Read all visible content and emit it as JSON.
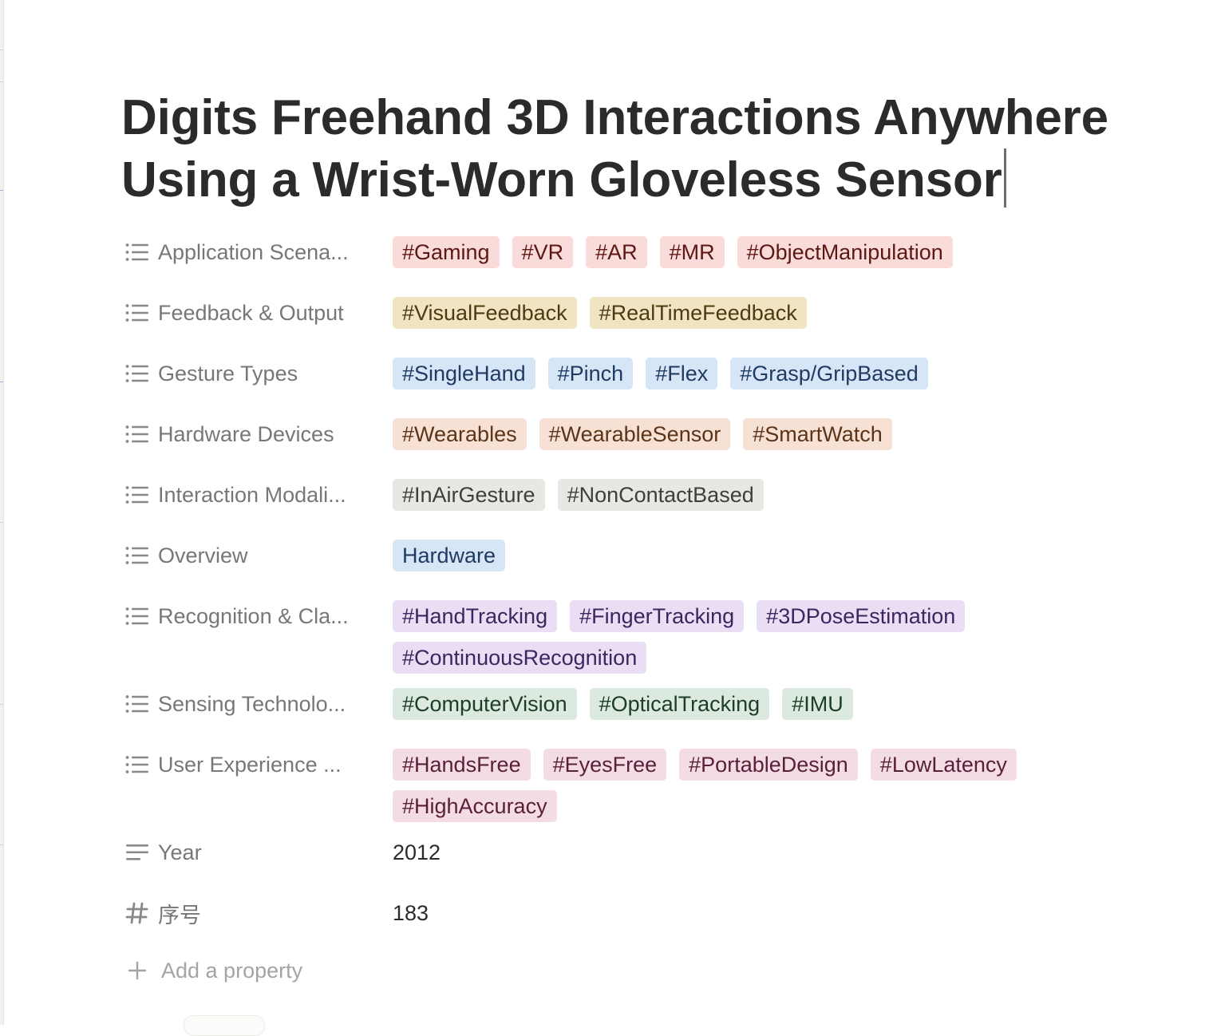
{
  "page": {
    "title": "Digits Freehand 3D Interactions Anywhere Using a Wrist-Worn Gloveless Sensor"
  },
  "colors": {
    "red_bg": "#f9dcd9",
    "red_fg": "#5d1715",
    "yellow_bg": "#f1e4c3",
    "yellow_fg": "#4f3a0f",
    "blue_bg": "#d7e6f7",
    "blue_fg": "#1f3b63",
    "orange_bg": "#f6e1d4",
    "orange_fg": "#5c3418",
    "gray_bg": "#e8e7e4",
    "gray_fg": "#3f3e3b",
    "purple_bg": "#e9def3",
    "purple_fg": "#3e2560",
    "green_bg": "#dbe9df",
    "green_fg": "#1e3c27",
    "pink_bg": "#f4dce5",
    "pink_fg": "#5a1f38"
  },
  "properties": [
    {
      "label": "Application Scena...",
      "icon": "list-icon",
      "color": "red",
      "tags": [
        "#Gaming",
        "#VR",
        "#AR",
        "#MR",
        "#ObjectManipulation"
      ]
    },
    {
      "label": "Feedback & Output",
      "icon": "list-icon",
      "color": "yellow",
      "tags": [
        "#VisualFeedback",
        "#RealTimeFeedback"
      ]
    },
    {
      "label": "Gesture Types",
      "icon": "list-icon",
      "color": "blue",
      "tags": [
        "#SingleHand",
        "#Pinch",
        "#Flex",
        "#Grasp/GripBased"
      ]
    },
    {
      "label": "Hardware Devices",
      "icon": "list-icon",
      "color": "orange",
      "tags": [
        "#Wearables",
        "#WearableSensor",
        "#SmartWatch"
      ]
    },
    {
      "label": "Interaction Modali...",
      "icon": "list-icon",
      "color": "gray",
      "tags": [
        "#InAirGesture",
        "#NonContactBased"
      ]
    },
    {
      "label": "Overview",
      "icon": "list-icon",
      "color": "blue",
      "tags": [
        "Hardware"
      ]
    },
    {
      "label": "Recognition & Cla...",
      "icon": "list-icon",
      "color": "purple",
      "tags": [
        "#HandTracking",
        "#FingerTracking",
        "#3DPoseEstimation",
        "#ContinuousRecognition"
      ]
    },
    {
      "label": "Sensing Technolo...",
      "icon": "list-icon",
      "color": "green",
      "tags": [
        "#ComputerVision",
        "#OpticalTracking",
        "#IMU"
      ]
    },
    {
      "label": "User Experience ...",
      "icon": "list-icon",
      "color": "pink",
      "tags": [
        "#HandsFree",
        "#EyesFree",
        "#PortableDesign",
        "#LowLatency",
        "#HighAccuracy"
      ]
    }
  ],
  "year": {
    "label": "Year",
    "icon": "text-lines-icon",
    "value": "2012"
  },
  "number": {
    "label": "序号",
    "icon": "hash-icon",
    "value": "183"
  },
  "add_property": {
    "label": "Add a property",
    "icon": "plus-icon"
  }
}
